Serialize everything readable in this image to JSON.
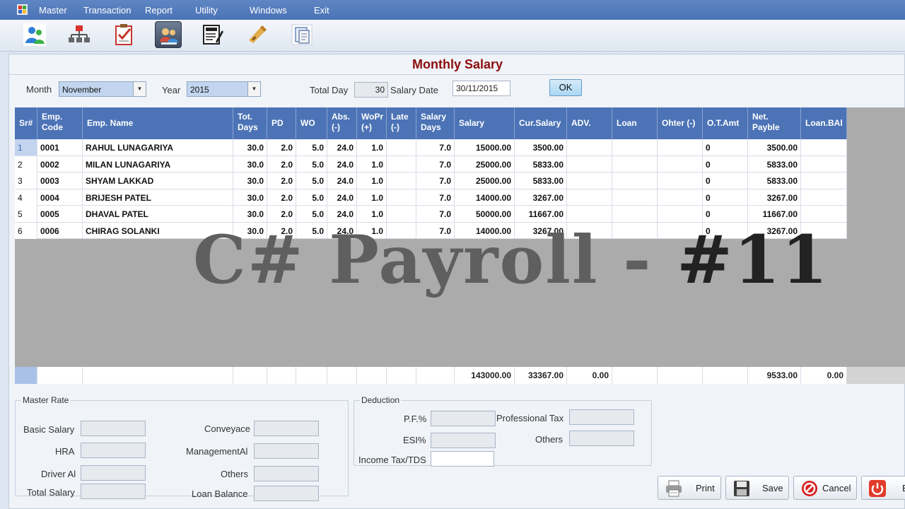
{
  "menu": [
    "Master",
    "Transaction",
    "Report",
    "Utility",
    "Windows",
    "Exit"
  ],
  "toolbar": {
    "icons": [
      "employee-icon",
      "organization-chart-icon",
      "checklist-icon",
      "salary-icon",
      "loan-icon",
      "tools-icon",
      "document-icon"
    ],
    "active_label": "Salary"
  },
  "form": {
    "title": "Monthly Salary",
    "month_label": "Month",
    "month_value": "November",
    "year_label": "Year",
    "year_value": "2015",
    "total_day_label": "Total Day",
    "total_day_value": "30",
    "salary_date_label": "Salary Date",
    "salary_date_value": "30/11/2015",
    "ok_label": "OK"
  },
  "grid": {
    "headers": [
      "Sr#",
      "Emp. Code",
      "Emp. Name",
      "Tot. Days",
      "PD",
      "WO",
      "Abs. (-)",
      "WoPr (+)",
      "Late (-)",
      "Salary Days",
      "Salary",
      "Cur.Salary",
      "ADV.",
      "Loan",
      "Ohter (-)",
      "O.T.Amt",
      "Net. Payble",
      "Loan.BAl"
    ],
    "rows": [
      [
        "1",
        "0001",
        "RAHUL LUNAGARIYA",
        "30.0",
        "2.0",
        "5.0",
        "24.0",
        "1.0",
        "",
        "7.0",
        "15000.00",
        "3500.00",
        "",
        "",
        "",
        "0",
        "3500.00",
        ""
      ],
      [
        "2",
        "0002",
        "MILAN LUNAGARIYA",
        "30.0",
        "2.0",
        "5.0",
        "24.0",
        "1.0",
        "",
        "7.0",
        "25000.00",
        "5833.00",
        "",
        "",
        "",
        "0",
        "5833.00",
        ""
      ],
      [
        "3",
        "0003",
        "SHYAM LAKKAD",
        "30.0",
        "2.0",
        "5.0",
        "24.0",
        "1.0",
        "",
        "7.0",
        "25000.00",
        "5833.00",
        "",
        "",
        "",
        "0",
        "5833.00",
        ""
      ],
      [
        "4",
        "0004",
        "BRIJESH PATEL",
        "30.0",
        "2.0",
        "5.0",
        "24.0",
        "1.0",
        "",
        "7.0",
        "14000.00",
        "3267.00",
        "",
        "",
        "",
        "0",
        "3267.00",
        ""
      ],
      [
        "5",
        "0005",
        "DHAVAL PATEL",
        "30.0",
        "2.0",
        "5.0",
        "24.0",
        "1.0",
        "",
        "7.0",
        "50000.00",
        "11667.00",
        "",
        "",
        "",
        "0",
        "11667.00",
        ""
      ],
      [
        "6",
        "0006",
        "CHIRAG SOLANKI",
        "30.0",
        "2.0",
        "5.0",
        "24.0",
        "1.0",
        "",
        "7.0",
        "14000.00",
        "3267.00",
        "",
        "",
        "",
        "0",
        "3267.00",
        ""
      ]
    ],
    "totals": [
      "",
      "",
      "",
      "",
      "",
      "",
      "",
      "",
      "",
      "",
      "143000.00",
      "33367.00",
      "0.00",
      "",
      "",
      "",
      "9533.00",
      "0.00"
    ]
  },
  "overlay": {
    "part1": "C# Payroll - ",
    "part2": "#11"
  },
  "master_rate": {
    "title": "Master Rate",
    "basic_salary_label": "Basic Salary",
    "hra_label": "HRA",
    "driver_label": "Driver Al",
    "total_salary_label": "Total Salary",
    "conveyance_label": "Conveyace",
    "management_label": "ManagementAl",
    "others_label": "Others",
    "loan_balance_label": "Loan Balance"
  },
  "deduction": {
    "title": "Deduction",
    "pf_label": "P.F.%",
    "esi_label": "ESI%",
    "income_tax_label": "Income Tax/TDS",
    "professional_tax_label": "Professional Tax",
    "others_label": "Others"
  },
  "actions": {
    "print_label": "Print",
    "save_label": "Save",
    "cancel_label": "Cancel",
    "exit_label": "E"
  },
  "colors": {
    "menubar": "#4a73b6",
    "grid_header": "#4c73b6",
    "title": "#8c0d0d",
    "selection": "#c3d4ef"
  }
}
